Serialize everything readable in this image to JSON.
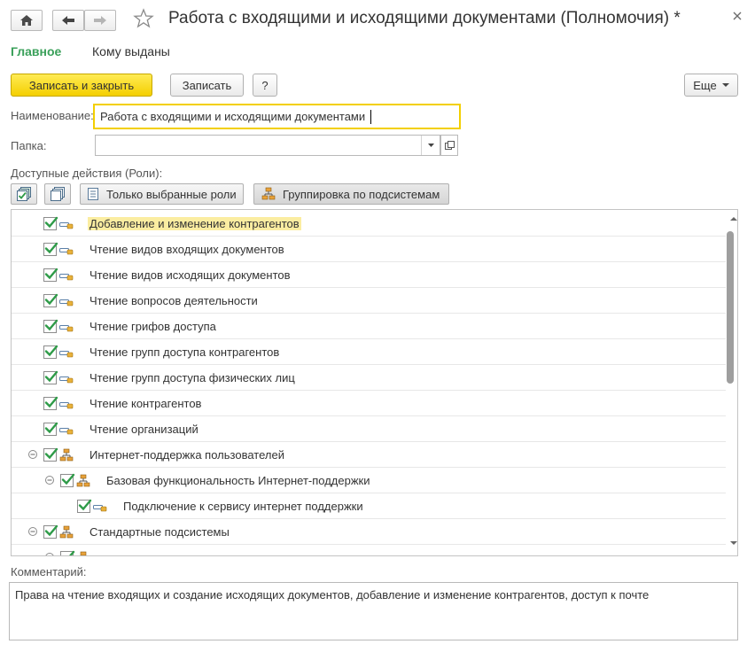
{
  "window": {
    "title": "Работа с входящими и исходящими документами (Полномочия) *",
    "home_icon": "home-icon",
    "back_icon": "arrow-left-icon",
    "forward_icon": "arrow-right-icon",
    "favorite_icon": "star-icon",
    "close_icon": "close-icon"
  },
  "tabs": [
    {
      "label": "Главное",
      "active": true
    },
    {
      "label": "Кому выданы",
      "active": false
    }
  ],
  "toolbar": {
    "save_close_label": "Записать и закрыть",
    "save_label": "Записать",
    "help_label": "?",
    "more_label": "Еще"
  },
  "form": {
    "name_label": "Наименование:",
    "name_value": "Работа с входящими и исходящими документами",
    "folder_label": "Папка:",
    "folder_value": "",
    "roles_label": "Доступные действия (Роли):"
  },
  "roles_toolbar": {
    "only_selected_label": "Только выбранные роли",
    "group_by_subsystems_label": "Группировка по подсистемам"
  },
  "tree": [
    {
      "label": "Добавление и изменение контрагентов",
      "type": "role",
      "level": 0,
      "checked": true,
      "highlight": true
    },
    {
      "label": "Чтение видов входящих документов",
      "type": "role",
      "level": 0,
      "checked": true
    },
    {
      "label": "Чтение видов исходящих документов",
      "type": "role",
      "level": 0,
      "checked": true
    },
    {
      "label": "Чтение вопросов деятельности",
      "type": "role",
      "level": 0,
      "checked": true
    },
    {
      "label": "Чтение грифов доступа",
      "type": "role",
      "level": 0,
      "checked": true
    },
    {
      "label": "Чтение групп доступа контрагентов",
      "type": "role",
      "level": 0,
      "checked": true
    },
    {
      "label": "Чтение групп доступа физических лиц",
      "type": "role",
      "level": 0,
      "checked": true
    },
    {
      "label": "Чтение контрагентов",
      "type": "role",
      "level": 0,
      "checked": true
    },
    {
      "label": "Чтение организаций",
      "type": "role",
      "level": 0,
      "checked": true
    },
    {
      "label": "Интернет-поддержка пользователей",
      "type": "subsystem",
      "level": 0,
      "checked": true,
      "expanded": true
    },
    {
      "label": "Базовая функциональность Интернет-поддержки",
      "type": "subsystem",
      "level": 1,
      "checked": true,
      "expanded": true
    },
    {
      "label": "Подключение к сервису интернет поддержки",
      "type": "role",
      "level": 2,
      "checked": true
    },
    {
      "label": "Стандартные подсистемы",
      "type": "subsystem",
      "level": 0,
      "checked": true,
      "expanded": true
    },
    {
      "label": "",
      "type": "subsystem",
      "level": 1,
      "checked": true,
      "expanded": true,
      "partial": true
    }
  ],
  "comment": {
    "label": "Комментарий:",
    "value": "Права на чтение входящих и создание исходящих документов, добавление и изменение контрагентов, доступ к почте"
  },
  "colors": {
    "accent_green": "#3aa05a",
    "primary_button": "#f4cf00",
    "focus_border": "#f3cf00",
    "highlight": "#fbeda1",
    "check_green": "#2e9b48"
  }
}
